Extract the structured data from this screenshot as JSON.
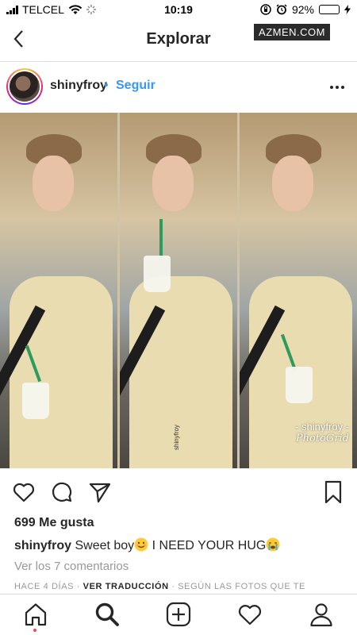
{
  "status_bar": {
    "carrier": "TELCEL",
    "time": "10:19",
    "battery_percent": "92%",
    "battery_level": 0.92
  },
  "nav": {
    "title": "Explorar",
    "watermark": "AZMEN.COM"
  },
  "post": {
    "username": "shinyfroy",
    "separator": "•",
    "follow_label": "Seguir",
    "photo_caption_line1": "- shinyfroy -",
    "photo_caption_line2": "PhotoGrid",
    "photo_vertical_tag": "shinyfroy",
    "likes": "699 Me gusta",
    "caption_user": "shinyfroy",
    "caption_text_1": "Sweet boy",
    "caption_text_2": " I NEED YOUR HUG",
    "view_comments": "Ver los 7 comentarios",
    "meta_time": "HACE 4 DÍAS",
    "meta_sep": " · ",
    "meta_translate": "VER TRADUCCIÓN",
    "meta_sep2": " · ",
    "meta_photos": "SEGÚN LAS FOTOS QUE TE"
  },
  "colors": {
    "accent_blue": "#3897f0",
    "text": "#262626",
    "muted": "#999999",
    "battery_green": "#4cd964",
    "notification_red": "#ed4956"
  },
  "icons": [
    "back-chevron-icon",
    "more-options-icon",
    "heart-icon",
    "comment-icon",
    "share-icon",
    "bookmark-icon",
    "home-icon",
    "search-icon",
    "add-post-icon",
    "activity-heart-icon",
    "profile-icon"
  ]
}
